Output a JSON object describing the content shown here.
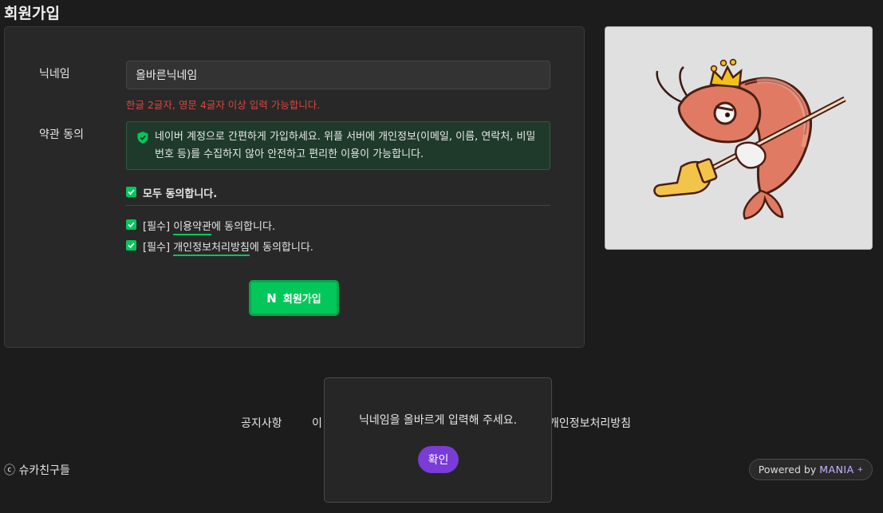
{
  "page": {
    "title": "회원가입"
  },
  "form": {
    "nickname_label": "닉네임",
    "nickname_value": "올바른닉네임",
    "nickname_error": "한글 2글자, 영문 4글자 이상 입력 가능합니다.",
    "terms_label": "약관 동의",
    "info_text": "네이버 계정으로 간편하게 가입하세요. 위플 서버에 개인정보(이메일, 이름, 연락처, 비밀번호 등)를 수집하지 않아 안전하고 편리한 이용이 가능합니다.",
    "agree_all": "모두 동의합니다.",
    "agree_terms": {
      "prefix": "[필수] ",
      "link": "이용약관",
      "suffix": "에 동의합니다."
    },
    "agree_privacy": {
      "prefix": "[필수] ",
      "link": "개인정보처리방침",
      "suffix": "에 동의합니다."
    },
    "join_button": {
      "logo": "N",
      "label": "회원가입"
    }
  },
  "footer": {
    "links": [
      "공지사항",
      "이",
      "개인정보처리방침"
    ],
    "copyright": "ⓒ 슈카친구들",
    "powered": {
      "prefix": "Powered by",
      "brand": "MANIA",
      "mark": "+"
    }
  },
  "dialog": {
    "message": "닉네임을 올바르게 입력해 주세요.",
    "confirm_label": "확인"
  },
  "colors": {
    "accent_green": "#03c75a",
    "error_red": "#d9463f",
    "dialog_button": "#7a3bd6"
  }
}
